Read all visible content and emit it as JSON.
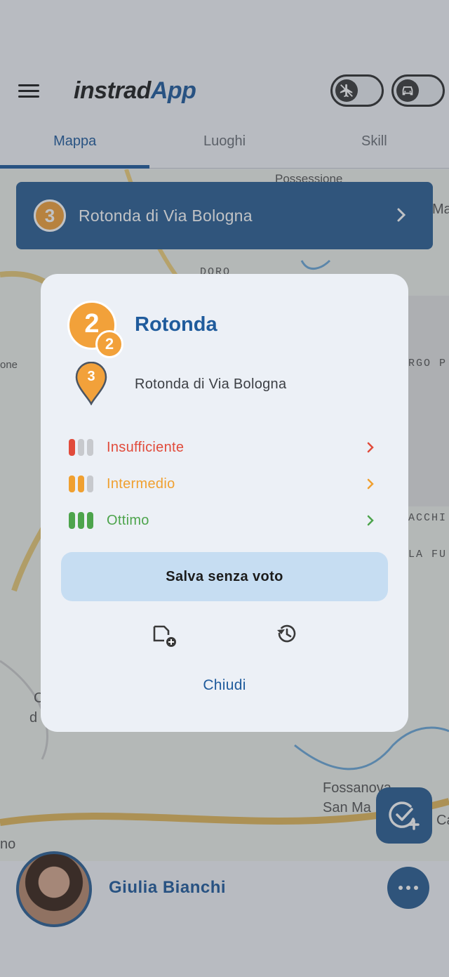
{
  "app": {
    "logo_part1": "instrad",
    "logo_part2": "App"
  },
  "tabs": [
    {
      "label": "Mappa",
      "active": true
    },
    {
      "label": "Luoghi",
      "active": false
    },
    {
      "label": "Skill",
      "active": false
    }
  ],
  "map": {
    "labels": [
      "Possessione",
      "Ma",
      "DORO",
      "one",
      "RGO P",
      "ACCHI",
      "LA FU",
      "C",
      "d",
      "Fossanova",
      "San Ma",
      "Ca",
      "no"
    ]
  },
  "place_banner": {
    "number": "3",
    "name": "Rotonda di Via Bologna"
  },
  "dialog": {
    "level_badge": "2",
    "sub_badge": "2",
    "title": "Rotonda",
    "pin_number": "3",
    "subtitle": "Rotonda di Via Bologna",
    "ratings": [
      {
        "label": "Insufficiente",
        "color": "#e14b3b",
        "filled": 1
      },
      {
        "label": "Intermedio",
        "color": "#f0a030",
        "filled": 2
      },
      {
        "label": "Ottimo",
        "color": "#4da44c",
        "filled": 3
      }
    ],
    "save_label": "Salva senza voto",
    "close_label": "Chiudi"
  },
  "user": {
    "name": "Giulia Bianchi"
  },
  "colors": {
    "primary": "#1f5b9c",
    "accent_orange": "#f2a13a"
  }
}
